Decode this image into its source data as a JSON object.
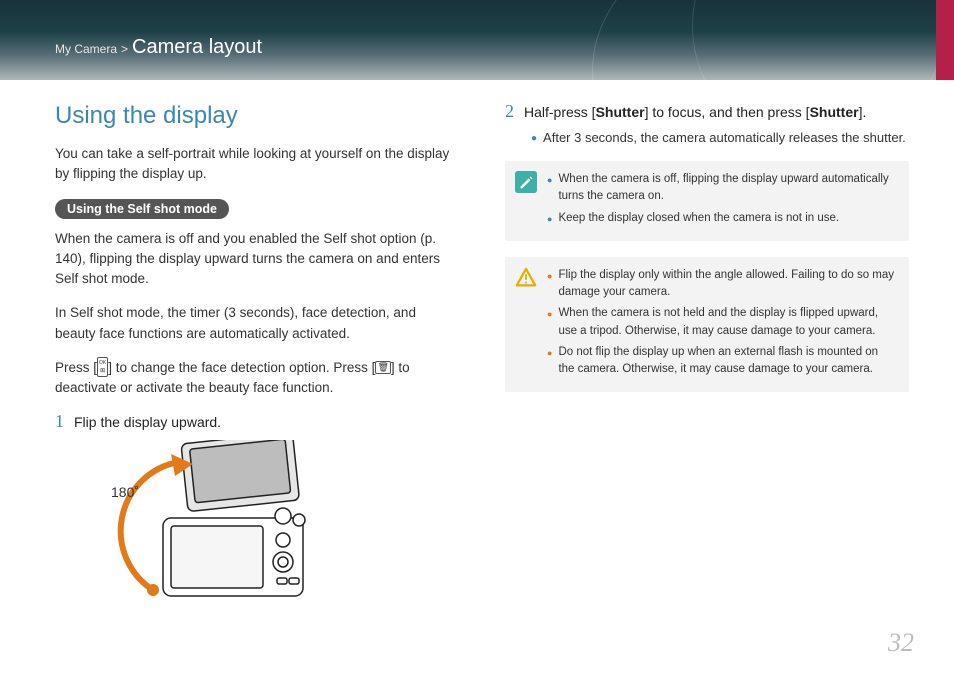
{
  "header": {
    "breadcrumb_parent": "My Camera",
    "breadcrumb_sep": ">",
    "breadcrumb_section": "Camera layout"
  },
  "left": {
    "title": "Using the display",
    "intro": "You can take a self-portrait while looking at yourself on the display by flipping the display up.",
    "pill": "Using the Self shot mode",
    "p1": "When the camera is off and you enabled the Self shot option (p. 140), flipping the display upward turns the camera on and enters Self shot mode.",
    "p2": "In Self shot mode, the timer (3 seconds), face detection, and beauty face functions are automatically activated.",
    "p3a": "Press [",
    "p3b": "] to change the face detection option. Press [",
    "p3c": "] to deactivate or activate the beauty face function.",
    "step1_num": "1",
    "step1_text": "Flip the display upward.",
    "angle_label": "180˚"
  },
  "right": {
    "step2_num": "2",
    "step2_a": "Half-press [",
    "step2_b": "Shutter",
    "step2_c": "] to focus, and then press [",
    "step2_d": "Shutter",
    "step2_e": "].",
    "step2_sub": "After 3 seconds, the camera automatically releases the shutter.",
    "note1_items": [
      "When the camera is off, flipping the display upward automatically turns the camera on.",
      "Keep the display closed when the camera is not in use."
    ],
    "note2_items": [
      "Flip the display only within the angle allowed. Failing to do so may damage your camera.",
      "When the camera is not held and the display is flipped upward, use a tripod. Otherwise, it may cause damage to your camera.",
      "Do not flip the display up when an external flash is mounted on the camera. Otherwise, it may cause damage to your camera."
    ]
  },
  "page_number": "32"
}
